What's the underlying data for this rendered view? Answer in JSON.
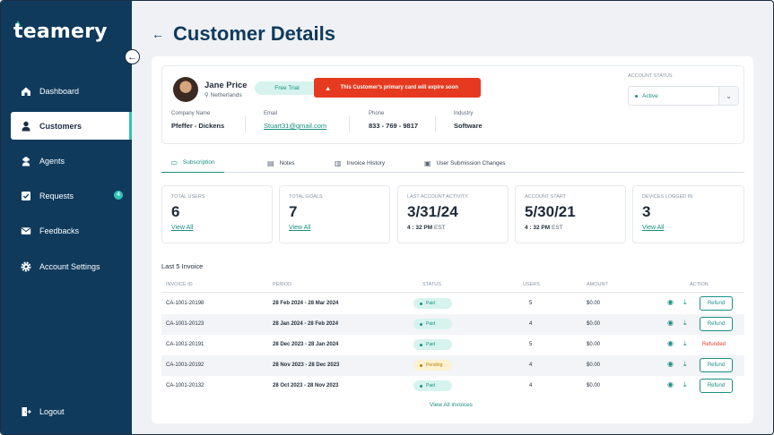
{
  "app": {
    "logo_text": "teamery"
  },
  "sidebar": {
    "items": [
      {
        "label": "Dashboard",
        "icon": "home-icon"
      },
      {
        "label": "Customers",
        "icon": "user-icon",
        "active": true
      },
      {
        "label": "Agents",
        "icon": "agents-icon"
      },
      {
        "label": "Requests",
        "icon": "requests-icon",
        "badge": "4"
      },
      {
        "label": "Feedbacks",
        "icon": "mail-icon"
      },
      {
        "label": "Account Settings",
        "icon": "gear-icon"
      }
    ],
    "logout": "Logout"
  },
  "header": {
    "title": "Customer Details"
  },
  "profile": {
    "name": "Jane Price",
    "location": "Netherlands",
    "plan": "Free Trial",
    "alert": "This Customer's primary card will expire soon",
    "account_status_label": "ACCOUNT STATUS",
    "account_status": "Active",
    "fields": [
      {
        "label": "Company Name",
        "value": "Pfeffer - Dickens"
      },
      {
        "label": "Email",
        "value": "Stuart31@gmail.com"
      },
      {
        "label": "Phone",
        "value": "833 - 769 - 9817"
      },
      {
        "label": "Industry",
        "value": "Software"
      }
    ]
  },
  "tabs": [
    {
      "label": "Subscription",
      "active": true
    },
    {
      "label": "Notes"
    },
    {
      "label": "Invoice History"
    },
    {
      "label": "User Submission Changes"
    }
  ],
  "stats": [
    {
      "label": "TOTAL USERS",
      "value": "6",
      "link": "View All"
    },
    {
      "label": "TOTAL GOALS",
      "value": "7",
      "link": "View All"
    },
    {
      "label": "LAST ACCOUNT ACTIVITY",
      "value": "3/31/24",
      "time": "4 : 32 PM",
      "tz": "EST"
    },
    {
      "label": "ACCOUNT START",
      "value": "5/30/21",
      "time": "4 : 32 PM",
      "tz": "EST"
    },
    {
      "label": "DEVICES LOGGED IN",
      "value": "3",
      "link": "View All"
    }
  ],
  "invoices": {
    "title": "Last 5 Invoice",
    "headers": [
      "INVOICE ID",
      "PERIOD",
      "STATUS",
      "USERS",
      "AMOUNT",
      "ACTION"
    ],
    "rows": [
      {
        "id": "CA-1001-20198",
        "period": "28 Feb 2024 - 28 Mar 2024",
        "status": "Paid",
        "users": "5",
        "amount": "$0.00",
        "action": "Refund"
      },
      {
        "id": "CA-1001-20123",
        "period": "28 Jan 2024 - 28 Feb 2024",
        "status": "Paid",
        "users": "4",
        "amount": "$0.00",
        "action": "Refund"
      },
      {
        "id": "CA-1001-20191",
        "period": "28 Dec 2023 - 28 Jan 2024",
        "status": "Paid",
        "users": "5",
        "amount": "$0.00",
        "action": "Refunded"
      },
      {
        "id": "CA-1001-20192",
        "period": "28 Nov 2023 - 28 Dec 2023",
        "status": "Pending",
        "users": "4",
        "amount": "$0.00",
        "action": "Refund"
      },
      {
        "id": "CA-1001-20132",
        "period": "28 Oct 2023 - 28 Nov 2023",
        "status": "Paid",
        "users": "4",
        "amount": "$0.00",
        "action": "Refund"
      }
    ],
    "view_all": "View All invoices"
  },
  "colors": {
    "sidebar": "#0f3a5c",
    "accent": "#1a8f84",
    "alert": "#e53a20"
  }
}
